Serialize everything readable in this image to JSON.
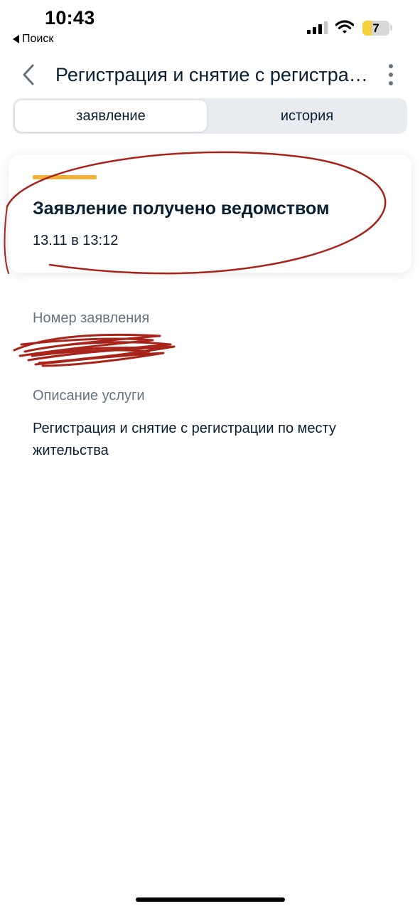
{
  "status_bar": {
    "time": "10:43",
    "back_to_app": "Поиск",
    "battery_level": "7",
    "battery_fraction": 0.35
  },
  "header": {
    "title": "Регистрация и снятие с регистрации по месту жительства",
    "back_icon": "chevron-left-icon",
    "more_icon": "more-vertical-icon"
  },
  "tabs": [
    {
      "label": "заявление",
      "active": true
    },
    {
      "label": "история",
      "active": false
    }
  ],
  "status_card": {
    "title": "Заявление получено ведомством",
    "date": "13.11 в 13:12",
    "accent_color": "#efb33d"
  },
  "fields": {
    "number_label": "Номер заявления",
    "description_label": "Описание услуги",
    "description_value": "Регистрация и снятие с регистрации по месту жительства"
  },
  "colors": {
    "text_primary": "#0b1f33",
    "text_secondary": "#66727f",
    "annotation": "#a8241a"
  }
}
